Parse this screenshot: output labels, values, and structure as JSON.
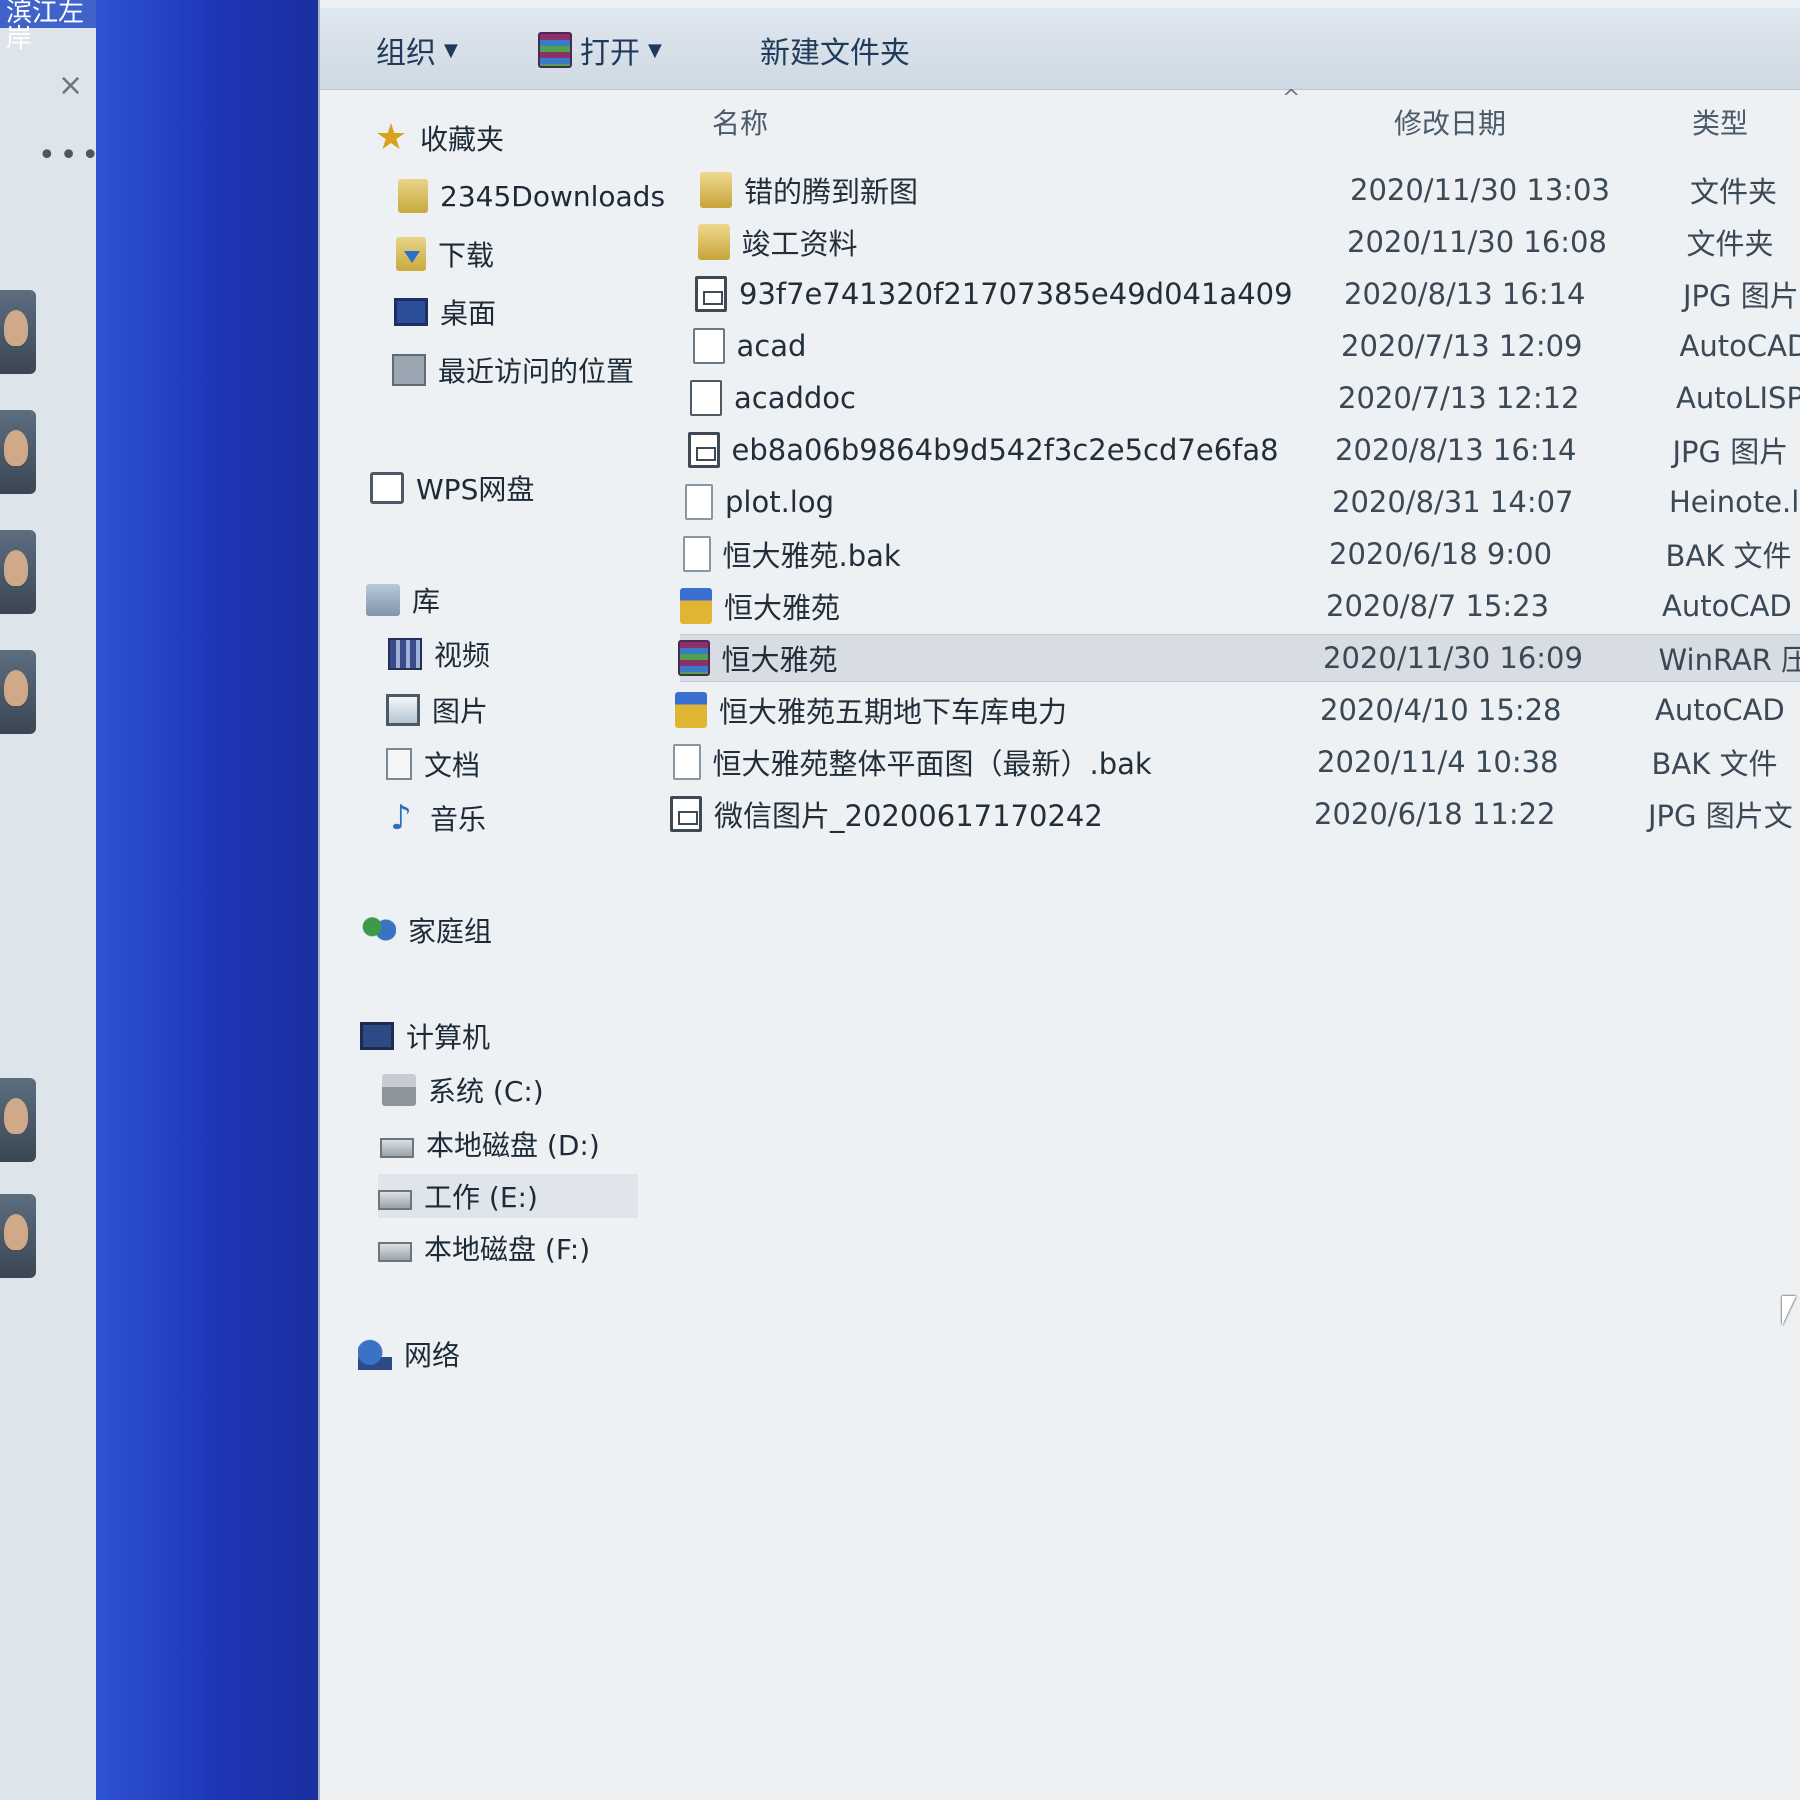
{
  "chat_panel": {
    "title": "滨江左岸",
    "close_glyph": "×",
    "more_glyph": "•••"
  },
  "toolbar": {
    "organize": "组织",
    "open": "打开",
    "new_folder": "新建文件夹",
    "caret": "▼"
  },
  "nav": {
    "favorites": "收藏夹",
    "downloads2345": "2345Downloads",
    "downloads": "下载",
    "desktop": "桌面",
    "recent": "最近访问的位置",
    "wps": "WPS网盘",
    "libraries": "库",
    "videos": "视频",
    "pictures": "图片",
    "documents": "文档",
    "music": "音乐",
    "homegroup": "家庭组",
    "computer": "计算机",
    "drive_c": "系统 (C:)",
    "drive_d": "本地磁盘 (D:)",
    "drive_e": "工作 (E:)",
    "drive_f": "本地磁盘 (F:)",
    "network": "网络"
  },
  "columns": {
    "name": "名称",
    "date": "修改日期",
    "type": "类型",
    "sort_glyph": "^"
  },
  "files": [
    {
      "name": "错的腾到新图",
      "date": "2020/11/30 13:03",
      "type": "文件夹",
      "icon": "folder-icon"
    },
    {
      "name": "竣工资料",
      "date": "2020/11/30 16:08",
      "type": "文件夹",
      "icon": "folder-icon"
    },
    {
      "name": "93f7e741320f21707385e49d041a409",
      "date": "2020/8/13 16:14",
      "type": "JPG 图片",
      "icon": "jpg-file-icon"
    },
    {
      "name": "acad",
      "date": "2020/7/13 12:09",
      "type": "AutoCAD",
      "icon": "fas-file-icon"
    },
    {
      "name": "acaddoc",
      "date": "2020/7/13 12:12",
      "type": "AutoLISP",
      "icon": "lsp-file-icon"
    },
    {
      "name": "eb8a06b9864b9d542f3c2e5cd7e6fa8",
      "date": "2020/8/13 16:14",
      "type": "JPG 图片",
      "icon": "jpg-file-icon"
    },
    {
      "name": "plot.log",
      "date": "2020/8/31 14:07",
      "type": "Heinote.l",
      "icon": "blank-file-icon"
    },
    {
      "name": "恒大雅苑.bak",
      "date": "2020/6/18 9:00",
      "type": "BAK 文件",
      "icon": "blank-file-icon"
    },
    {
      "name": "恒大雅苑",
      "date": "2020/8/7 15:23",
      "type": "AutoCAD",
      "icon": "dwg-file-icon"
    },
    {
      "name": "恒大雅苑",
      "date": "2020/11/30 16:09",
      "type": "WinRAR 压",
      "icon": "rar-file-icon"
    },
    {
      "name": "恒大雅苑五期地下车库电力",
      "date": "2020/4/10 15:28",
      "type": "AutoCAD",
      "icon": "dwg-file-icon"
    },
    {
      "name": "恒大雅苑整体平面图（最新）.bak",
      "date": "2020/11/4 10:38",
      "type": "BAK 文件",
      "icon": "blank-file-icon"
    },
    {
      "name": "微信图片_20200617170242",
      "date": "2020/6/18 11:22",
      "type": "JPG 图片文",
      "icon": "jpg-file-icon"
    }
  ],
  "colors": {
    "desktop_blue": "#2f52d4",
    "selection": "#d7dde3"
  }
}
